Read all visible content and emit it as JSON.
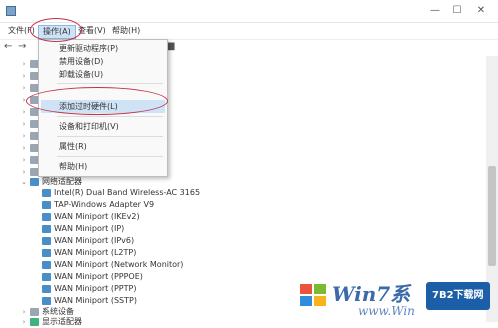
{
  "window": {
    "title": "",
    "controls": {
      "minimize": "—",
      "maximize": "☐",
      "close": "✕"
    }
  },
  "menubar": {
    "items": [
      "文件(F)",
      "操作(A)",
      "查看(V)",
      "帮助(H)"
    ]
  },
  "dropdown": {
    "items": [
      {
        "label": "更新驱动程序(P)",
        "highlighted": false,
        "disabled": false
      },
      {
        "label": "禁用设备(D)",
        "highlighted": false,
        "disabled": false
      },
      {
        "label": "卸载设备(U)",
        "highlighted": false,
        "disabled": false
      },
      {
        "label": "",
        "highlighted": false,
        "disabled": false
      },
      {
        "label": "添加过时硬件(L)",
        "highlighted": true,
        "disabled": false
      },
      {
        "label": "设备和打印机(V)",
        "highlighted": false,
        "disabled": false
      },
      {
        "label": "属性(R)",
        "highlighted": false,
        "disabled": false
      },
      {
        "label": "帮助(H)",
        "highlighted": false,
        "disabled": false
      }
    ]
  },
  "tree": {
    "category": "网络适配器",
    "adapters": [
      "Intel(R) Dual Band Wireless-AC 3165",
      "TAP-Windows Adapter V9",
      "WAN Miniport (IKEv2)",
      "WAN Miniport (IP)",
      "WAN Miniport (IPv6)",
      "WAN Miniport (L2TP)",
      "WAN Miniport (Network Monitor)",
      "WAN Miniport (PPPOE)",
      "WAN Miniport (PPTP)",
      "WAN Miniport (SSTP)"
    ],
    "footer_items": [
      "系统设备",
      "显示适配器"
    ]
  },
  "watermark": {
    "brand": "Win7系",
    "sub": "www.Win",
    "badge": "7B2下载网"
  },
  "colors": {
    "annotation": "#c0314a",
    "highlight": "#cfe3f7",
    "net_icon": "#4a8ec9"
  }
}
